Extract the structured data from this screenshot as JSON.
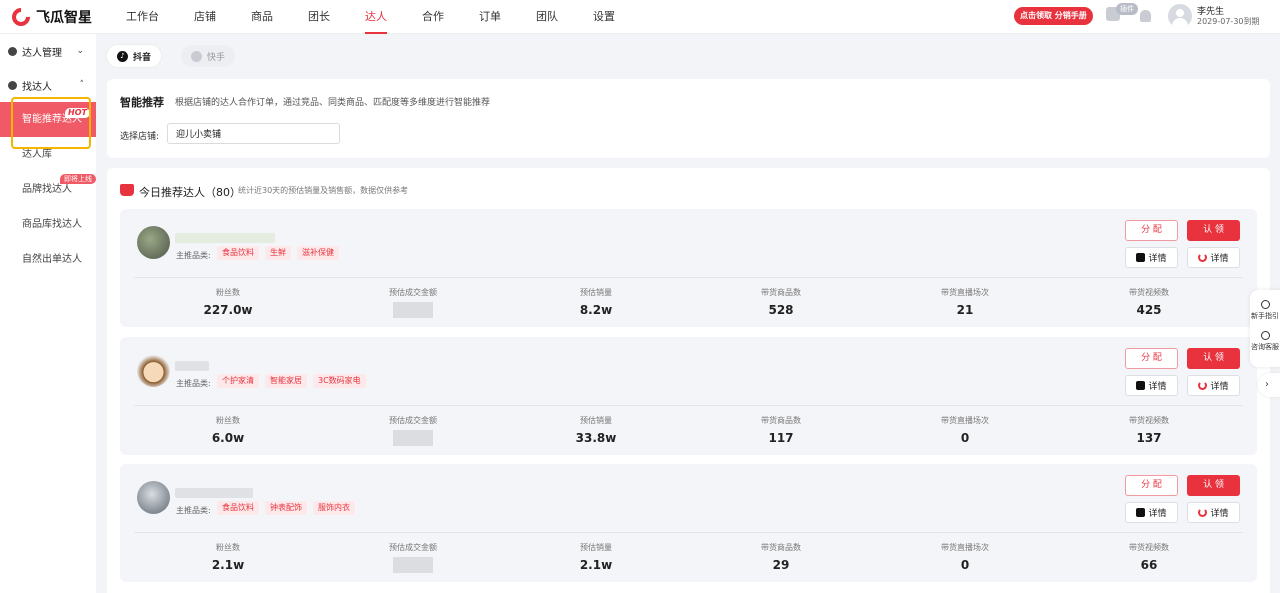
{
  "brand": {
    "name": "飞瓜智星",
    "accent": "#e8333f"
  },
  "nav": [
    {
      "label": "工作台",
      "active": false
    },
    {
      "label": "店铺",
      "active": false
    },
    {
      "label": "商品",
      "active": false
    },
    {
      "label": "团长",
      "active": false
    },
    {
      "label": "达人",
      "active": true
    },
    {
      "label": "合作",
      "active": false
    },
    {
      "label": "订单",
      "active": false
    },
    {
      "label": "团队",
      "active": false
    },
    {
      "label": "设置",
      "active": false
    }
  ],
  "header": {
    "promo": "点击领取 分销手册",
    "plugin_badge": "插件",
    "user_name": "李先生",
    "user_expiry": "2029-07-30到期"
  },
  "sidebar": {
    "group1": "达人管理",
    "group2": "找达人",
    "items": [
      {
        "label": "智能推荐达人",
        "badge": "HOT",
        "active": true
      },
      {
        "label": "达人库",
        "badge": "",
        "active": false
      },
      {
        "label": "品牌找达人",
        "badge": "即将上线",
        "active": false
      },
      {
        "label": "商品库找达人",
        "badge": "",
        "active": false
      },
      {
        "label": "自然出单达人",
        "badge": "",
        "active": false
      }
    ]
  },
  "platform_tabs": {
    "douyin": "抖音",
    "kuaishou": "快手"
  },
  "smart": {
    "title": "智能推荐",
    "desc": "根据店铺的达人合作订单，通过竞品、同类商品、匹配度等多维度进行智能推荐",
    "store_label": "选择店铺:",
    "store_value": "迎儿小卖铺"
  },
  "today": {
    "title": "今日推荐达人（80）",
    "note": "统计近30天的预估销量及销售额，数据仅供参考"
  },
  "card_labels": {
    "category": "主推品类:",
    "assign": "分 配",
    "claim": "认 领",
    "dy_detail": "详情",
    "ks_detail": "详情",
    "stats": [
      "粉丝数",
      "预估成交金额",
      "预估销量",
      "带货商品数",
      "带货直播场次",
      "带货视频数"
    ]
  },
  "creators": [
    {
      "tags": [
        "食品饮料",
        "生鲜",
        "滋补保健"
      ],
      "fans": "227.0w",
      "sales": "8.2w",
      "products": "528",
      "lives": "21",
      "videos": "425"
    },
    {
      "tags": [
        "个护家清",
        "智能家居",
        "3C数码家电"
      ],
      "fans": "6.0w",
      "sales": "33.8w",
      "products": "117",
      "lives": "0",
      "videos": "137"
    },
    {
      "tags": [
        "食品饮料",
        "钟表配饰",
        "服饰内衣"
      ],
      "fans": "2.1w",
      "sales": "2.1w",
      "products": "29",
      "lives": "0",
      "videos": "66"
    }
  ],
  "float": {
    "guide": "新手指引",
    "service": "咨询客服",
    "arrow": "›"
  }
}
